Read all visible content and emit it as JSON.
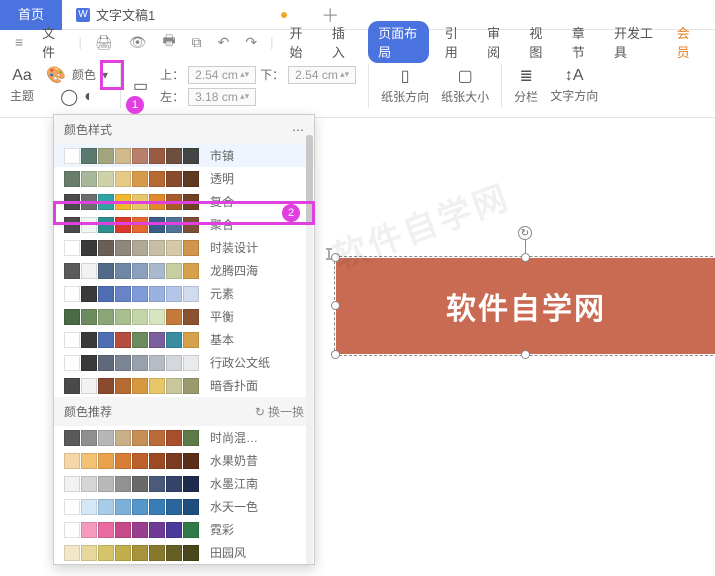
{
  "tabs": {
    "home": "首页",
    "doc": "文字文稿1"
  },
  "menu": {
    "file": "文件",
    "items": [
      "开始",
      "插入",
      "页面布局",
      "引用",
      "审阅",
      "视图",
      "章节",
      "开发工具",
      "会员"
    ]
  },
  "ribbon": {
    "theme": "主题",
    "color": "颜色",
    "spin": {
      "top_label": "上：",
      "bottom_label": "下：",
      "left_label": "左：",
      "top": "2.54 cm",
      "bottom": "2.54 cm",
      "left": "3.18 cm"
    },
    "paper_dir": "纸张方向",
    "paper_size": "纸张大小",
    "cols": "分栏",
    "text_dir": "文字方向"
  },
  "popup": {
    "header": "颜色样式",
    "refresh": "换一换",
    "reco_header": "颜色推荐",
    "rows": [
      {
        "name": "市镇",
        "hovered": true,
        "c": [
          "#ffffff",
          "#5a7a6e",
          "#a2a57e",
          "#d0b98a",
          "#b97f6a",
          "#9a5b44",
          "#6d4f3d",
          "#444"
        ]
      },
      {
        "name": "透明",
        "c": [
          "#6a7d6d",
          "#a7b89a",
          "#cfd2a7",
          "#e7c988",
          "#d79a4a",
          "#b66a32",
          "#8a4a2e",
          "#5e3a23"
        ]
      },
      {
        "name": "复合",
        "c": [
          "#4a4a4a",
          "#6d6d6d",
          "#2fa2a3",
          "#f2b631",
          "#e7c769",
          "#e08a2b",
          "#a55c2d",
          "#6f4224"
        ]
      },
      {
        "name": "聚合",
        "c": [
          "#4a4a4a",
          "#eef7f2",
          "#2c8e8f",
          "#d93a2b",
          "#e5692e",
          "#3a5d88",
          "#51739b",
          "#7b4f3a"
        ]
      },
      {
        "name": "时装设计",
        "c": [
          "#ffffff",
          "#3a3a3a",
          "#6a5f56",
          "#8f867c",
          "#b2a898",
          "#c9bfa8",
          "#d6c9a7",
          "#d1954a"
        ]
      },
      {
        "name": "龙腾四海",
        "c": [
          "#5b5b5b",
          "#f2f2f2",
          "#516a88",
          "#6e87a6",
          "#8aa0bd",
          "#a9bacd",
          "#c7cfa1",
          "#d7a04a"
        ]
      },
      {
        "name": "元素",
        "c": [
          "#ffffff",
          "#3a3a3a",
          "#4f6db2",
          "#6784c9",
          "#7f9cd8",
          "#99b2e0",
          "#b4c7e8",
          "#d0dbf0"
        ]
      },
      {
        "name": "平衡",
        "c": [
          "#4a6a46",
          "#6c8b5f",
          "#8aa677",
          "#a7bf8f",
          "#c3d6a8",
          "#d8e5be",
          "#c47a3a",
          "#8a5230"
        ]
      },
      {
        "name": "基本",
        "c": [
          "#ffffff",
          "#3a3a3a",
          "#4f6db2",
          "#b64d3e",
          "#6c8b5f",
          "#7a5ea0",
          "#3a8da0",
          "#d7a04a"
        ]
      },
      {
        "name": "行政公文纸",
        "c": [
          "#ffffff",
          "#3a3a3a",
          "#5e6a7a",
          "#7a8694",
          "#98a1ab",
          "#b6bcc3",
          "#d4d7db",
          "#e9eaec"
        ]
      },
      {
        "name": "暗香扑面",
        "c": [
          "#4a4a4a",
          "#f2f2f2",
          "#8a4a2e",
          "#b66a32",
          "#d6993e",
          "#e7c769",
          "#c9c79a",
          "#9a9a6d"
        ]
      }
    ],
    "reco": [
      {
        "name": "时尚混…",
        "c": [
          "#5a5a5a",
          "#8f8f8f",
          "#b7b7b7",
          "#c9b088",
          "#c78f56",
          "#bb6a3a",
          "#a84e2c",
          "#5e7a46"
        ]
      },
      {
        "name": "水果奶昔",
        "c": [
          "#f5d7a7",
          "#f3c274",
          "#e9a34a",
          "#d77e36",
          "#bd5f2a",
          "#9d4a24",
          "#7a3b1f",
          "#5a2e18"
        ]
      },
      {
        "name": "水墨江南",
        "c": [
          "#f2f2f2",
          "#d6d6d6",
          "#b8b8b8",
          "#929292",
          "#6a6a6a",
          "#4c5a7a",
          "#33436a",
          "#1e2b4d"
        ]
      },
      {
        "name": "水天一色",
        "c": [
          "#ffffff",
          "#d6e8f5",
          "#a7cce8",
          "#7ab0da",
          "#5596cb",
          "#397db7",
          "#2a659b",
          "#1e4e7d"
        ]
      },
      {
        "name": "霓彩",
        "c": [
          "#ffffff",
          "#f59bc0",
          "#e86aa0",
          "#c84a8a",
          "#9a3f8f",
          "#6f3b96",
          "#4a3a9a",
          "#2f7a46"
        ]
      },
      {
        "name": "田园风",
        "c": [
          "#f2e7c9",
          "#e6d79a",
          "#d7c46a",
          "#c2ae4a",
          "#a6933a",
          "#86792e",
          "#665f24",
          "#4a471c"
        ]
      }
    ]
  },
  "canvas": {
    "shape_text": "软件自学网",
    "watermark": "软件自学网"
  }
}
